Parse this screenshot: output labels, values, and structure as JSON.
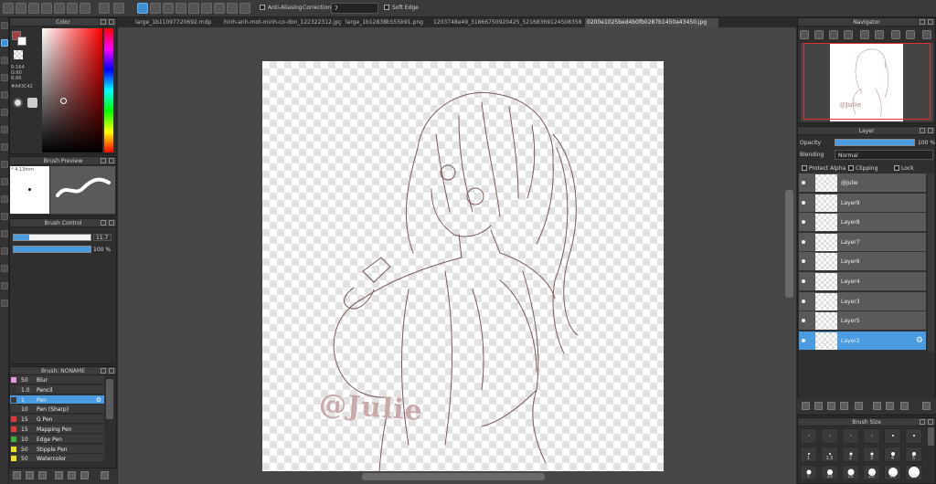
{
  "toolbar": {
    "anti_aliasing_label": "Anti-Aliasing",
    "correction_label": "Correction",
    "correction_value": "7",
    "soft_edge_label": "Soft Edge"
  },
  "tabs": [
    {
      "label": "large_1b11097720692.mdp",
      "active": false
    },
    {
      "label": "hinh-anh-mot-minh-co-don_122322312.jpg",
      "active": false
    },
    {
      "label": "large_1b12838b555b91.png",
      "active": false
    },
    {
      "label": "1203748e49_31866750920425_521683691245083589_n.png",
      "active": false
    },
    {
      "label": "0200e1025bed4b0fb0287b1450a43450.jpg",
      "active": true
    }
  ],
  "color_panel": {
    "title": "Color",
    "readout_r": "R:164",
    "readout_g": "G:60",
    "readout_b": "B:66",
    "hex": "#A43C42",
    "fg_color": "#a43c42",
    "bg_color": "#ffffff"
  },
  "brush_preview": {
    "title": "Brush Preview",
    "size_label": "* 4.13mm"
  },
  "brush_control": {
    "title": "Brush Control",
    "size_value": "11.7",
    "size_fraction": 0.2,
    "opacity_value": "100 %",
    "opacity_fraction": 1.0
  },
  "brush_list": {
    "title": "Brush: NONAME",
    "items": [
      {
        "size": "50",
        "name": "Blur",
        "color": "#e59ae0",
        "selected": false
      },
      {
        "size": "1.0",
        "name": "Pencil",
        "color": "#333333",
        "selected": false
      },
      {
        "size": "1",
        "name": "Pen",
        "color": "#3a3a3a",
        "selected": true
      },
      {
        "size": "10",
        "name": "Pen (Sharp)",
        "color": "#3a3a3a",
        "selected": false
      },
      {
        "size": "15",
        "name": "G Pen",
        "color": "#e03a3a",
        "selected": false
      },
      {
        "size": "15",
        "name": "Mapping Pen",
        "color": "#e03a3a",
        "selected": false
      },
      {
        "size": "10",
        "name": "Edge Pen",
        "color": "#3ab03a",
        "selected": false
      },
      {
        "size": "50",
        "name": "Stipple Pen",
        "color": "#e8e02a",
        "selected": false
      },
      {
        "size": "50",
        "name": "Watercolor",
        "color": "#e8e02a",
        "selected": false
      }
    ]
  },
  "canvas": {
    "watermark": "@Julie"
  },
  "navigator": {
    "title": "Navigator",
    "thumb_text": "@Julie"
  },
  "layer_panel": {
    "title": "Layer",
    "opacity_label": "Opacity",
    "opacity_value": "100 %",
    "opacity_fraction": 1.0,
    "blending_label": "Blending",
    "blending_value": "Normal",
    "protect_alpha_label": "Protect Alpha",
    "clipping_label": "Clipping",
    "lock_label": "Lock",
    "layers": [
      {
        "name": "@Julie",
        "selected": false
      },
      {
        "name": "Layer9",
        "selected": false
      },
      {
        "name": "Layer8",
        "selected": false
      },
      {
        "name": "Layer7",
        "selected": false
      },
      {
        "name": "Layer6",
        "selected": false
      },
      {
        "name": "Layer4",
        "selected": false
      },
      {
        "name": "Layer3",
        "selected": false
      },
      {
        "name": "Layer5",
        "selected": false
      },
      {
        "name": "Layer2",
        "selected": true
      }
    ]
  },
  "brush_size_panel": {
    "title": "Brush Size",
    "row1": [
      "",
      "",
      "",
      "",
      "",
      ""
    ],
    "row2": [
      "1",
      "1.5",
      "2",
      "3",
      "4",
      "5"
    ],
    "row3": [
      "7",
      "10",
      "15",
      "20",
      "30",
      "50"
    ],
    "row1_dot_sizes": [
      1,
      1,
      1,
      1,
      2,
      2
    ],
    "row2_dot_sizes": [
      2,
      2,
      3,
      3,
      4,
      4
    ],
    "row3_dot_sizes": [
      5,
      6,
      7,
      8,
      10,
      12
    ]
  }
}
